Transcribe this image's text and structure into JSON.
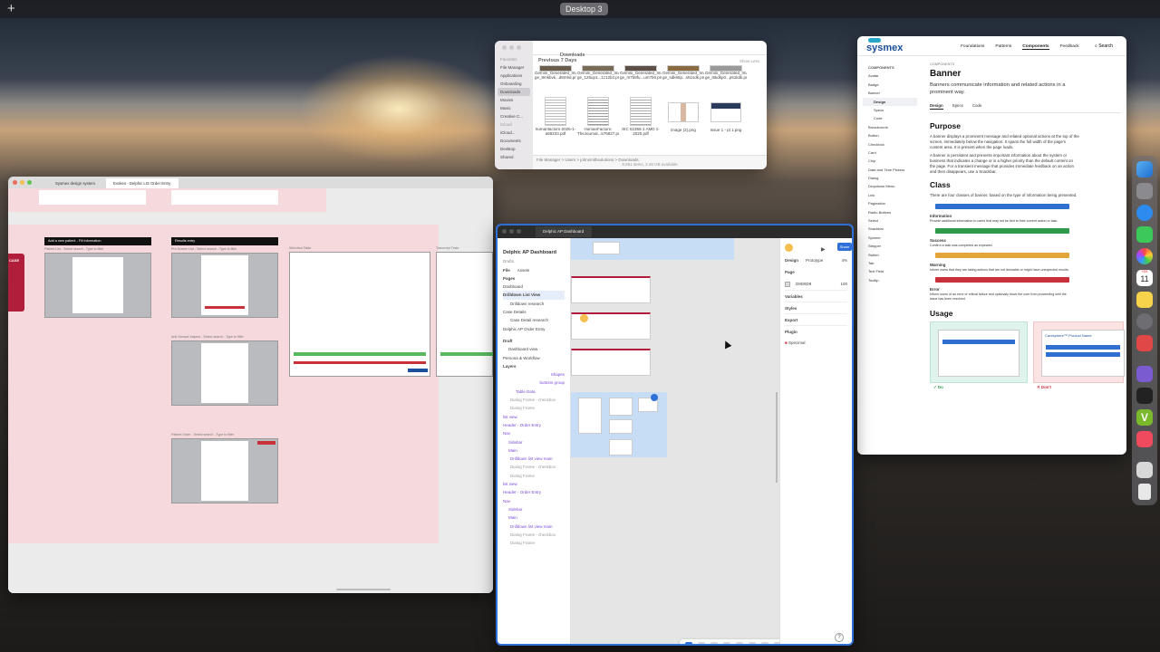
{
  "desktop": {
    "name": "Desktop 3",
    "add_label": "+"
  },
  "finder": {
    "toolbar_title": "Downloads",
    "section": "Previous 7 Days",
    "show_less": "Show Less",
    "sidebar": [
      "Favorites",
      "File Manager",
      "Applications",
      "Onboarding",
      "Downloads",
      "Movies",
      "Music",
      "Creative C...",
      "iCloud",
      "iCloud...",
      "Documents",
      "Desktop",
      "Shared"
    ],
    "row1": [
      "Gemini_Generated_Ima ge_8mkbvk...d8m5d.png",
      "Gemini_Generated_Ima ge_125up1...1z12b2.png",
      "Gemini_Generated_Ima ge_m7b8fu...um7b0.png",
      "Gemini_Generated_Ima ge_sdk65p...s51sdk.png",
      "Gemini_Generated_Ima ge_i5kdkp0...p51kdk.png"
    ],
    "row2": [
      "humanfactors-2025-1-a69233.pdf",
      "HumanFactors-TheJournal...576827.pdf",
      "IEC 62366-1 AMD 1-2020.pdf",
      "image (2).png",
      "Issue 1 - pt 1.png"
    ],
    "path": "File Manager > Users > johnsmithsolutions > Downloads",
    "status": "8,951 items, 2.48 GB available"
  },
  "sysmex": {
    "logo": "sysmex",
    "nav": [
      "Foundations",
      "Patterns",
      "Components",
      "Feedback"
    ],
    "search": "Search",
    "side_heading": "COMPONENTS",
    "side_items": [
      "Avatar",
      "Badge",
      "Banner",
      "Design",
      "Specs",
      "Code",
      "Breadcrumb",
      "Button",
      "Checkbox",
      "Card",
      "Chip",
      "Date and Time Pickers",
      "Dialog",
      "Dropdown Menu",
      "Link",
      "Pagination",
      "Radio Buttons",
      "Select",
      "Snackbar",
      "Spinner",
      "Stepper",
      "Switch",
      "Tab",
      "Text Field",
      "Tooltip"
    ],
    "eyebrow": "COMPONENTS",
    "title": "Banner",
    "lede": "Banners communicate information and related actions in a prominent way.",
    "tabs": [
      "Design",
      "Specs",
      "Code"
    ],
    "purpose_h": "Purpose",
    "purpose_p1": "A banner displays a prominent message and related optional actions at the top of the screen, immediately below the navigation. It spans the full width of the page's content area. It is present when the page loads.",
    "purpose_p2": "A banner is persistent and presents important information about the system or business that indicates a change or is a higher priority than the default content on the page. For a transient message that provides immediate feedback on an action and then disappears, use a Snackbar.",
    "class_h": "Class",
    "class_p": "There are four classes of banner, based on the type of information being presented.",
    "classes": [
      {
        "name": "Information",
        "desc": "Provide additional information to users that may not be tied to their current action or task.",
        "color": "#2f6fd0"
      },
      {
        "name": "Success",
        "desc": "Confirm a task was completed as expected.",
        "color": "#2e9a4a"
      },
      {
        "name": "Warning",
        "desc": "Inform users that they are taking actions that are not desirable or might have unexpected results.",
        "color": "#e3a43a"
      },
      {
        "name": "Error",
        "desc": "Inform users of an error or critical failure and optionally block the user from proceeding until the issue has been resolved.",
        "color": "#c8303a"
      }
    ],
    "usage_h": "Usage",
    "do_label": "Do",
    "dont_label": "Don't",
    "usage_card_title": "Caresphere™ Product Name"
  },
  "figma": {
    "tab": "Delphic AP Dashboard",
    "file": "Delphic AP Dashboard",
    "drafts": "Drafts",
    "left_tabs": [
      "File",
      "Assets"
    ],
    "pages_label": "Pages",
    "pages": [
      "Dashboard",
      "Drilldown List View",
      "Drilldown research",
      "Case Details",
      "Case Detail research",
      "Delphic AP Order Entry"
    ],
    "draft_label": "Draft",
    "draft_items": [
      "Dashboard view",
      "Persona & Workflow"
    ],
    "layers_label": "Layers",
    "layers": [
      "Shapes",
      "buttons group",
      "Table Data",
      "Dialog Frame - checkbox",
      "Dialog Frame",
      "list view",
      "Header - Order Entry",
      "Nav",
      "Sidebar",
      "Main",
      "Drilldown list view main",
      "Dialog Frame - checkbox",
      "Dialog Frame",
      "list view",
      "Header - Order Entry",
      "Nav",
      "Sidebar",
      "Main",
      "Drilldown list view main",
      "Dialog Frame - checkbox",
      "Dialog Frame"
    ],
    "right_tabs": [
      "Design",
      "Prototype"
    ],
    "share": "Share",
    "zoom": "4%",
    "page_label": "Page",
    "page_color": "D9D9D9",
    "page_opacity": "100",
    "variables": "Variables",
    "styles": "Styles",
    "export": "Export",
    "plugin": "Plugin",
    "plugin_name": "Specimal"
  },
  "chrome": {
    "tabs": [
      "Sysmex design system",
      "Evokes - Delphic LIS Order Entry"
    ],
    "section_titles": [
      "Add a new patient - Fill information",
      "Results entry",
      "Selection Table",
      "Transcript Tests"
    ],
    "captions": [
      "Patient List - Select search - Type to filter",
      "Pre-Screen List - Select search - Type to filter",
      "Anti-Sample Inspect - Select search - Type to filter",
      "Patient Order - Select search - Type to filter"
    ],
    "case_label": "CASE"
  },
  "dock": {
    "calendar_month": "FEB",
    "calendar_day": "11"
  }
}
